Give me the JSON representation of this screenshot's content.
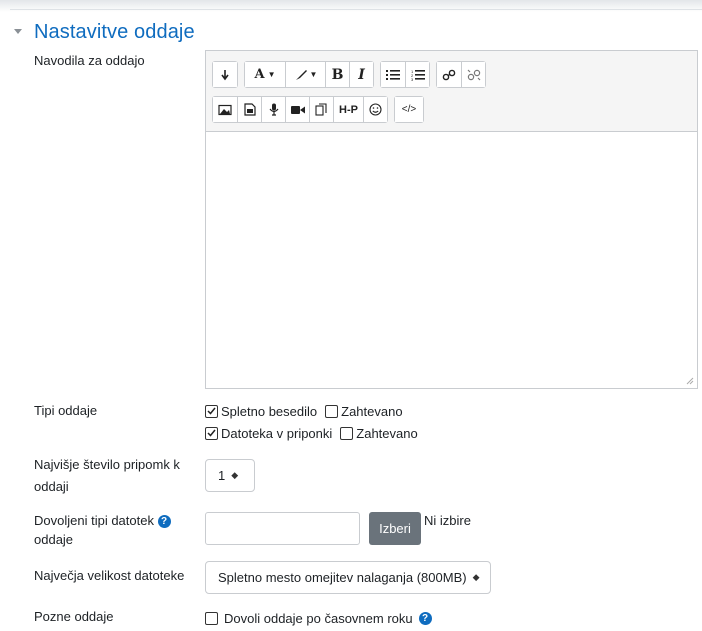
{
  "section": {
    "title": "Nastavitve oddaje",
    "collapse_icon": "chevron-down-icon"
  },
  "instructions": {
    "label": "Navodila za oddajo",
    "toolbar": {
      "row1": [
        {
          "name": "collapse-toolbar-button",
          "glyph": "↴"
        },
        {
          "name": "font-size-button",
          "glyph": "A▾"
        },
        {
          "name": "text-color-button",
          "glyph": "✎▾"
        },
        {
          "name": "bold-button",
          "glyph": "B"
        },
        {
          "name": "italic-button",
          "glyph": "I"
        },
        {
          "name": "unordered-list-button",
          "glyph": "☰"
        },
        {
          "name": "ordered-list-button",
          "glyph": "≡"
        },
        {
          "name": "link-button",
          "glyph": "🔗"
        },
        {
          "name": "unlink-button",
          "glyph": "⛓"
        }
      ],
      "row2": [
        {
          "name": "image-button",
          "glyph": "▣"
        },
        {
          "name": "media-button",
          "glyph": "▤"
        },
        {
          "name": "record-audio-button",
          "glyph": "🎙"
        },
        {
          "name": "record-video-button",
          "glyph": "■◀"
        },
        {
          "name": "manage-files-button",
          "glyph": "⧉"
        },
        {
          "name": "h5p-button",
          "glyph": "H-P"
        },
        {
          "name": "emoji-button",
          "glyph": "☺"
        },
        {
          "name": "html-button",
          "glyph": "</>"
        }
      ]
    }
  },
  "submission_types": {
    "label": "Tipi oddaje",
    "online_text": {
      "label": "Spletno besedilo",
      "checked": true
    },
    "online_text_required": {
      "label": "Zahtevano",
      "checked": false
    },
    "file": {
      "label": "Datoteka v priponki",
      "checked": true
    },
    "file_required": {
      "label": "Zahtevano",
      "checked": false
    }
  },
  "max_files": {
    "label_line1": "Najvišje število pripomk k",
    "label_line2": "oddaji",
    "value": "1"
  },
  "allowed_types": {
    "label_line1": "Dovoljeni tipi datotek",
    "label_line2": "oddaje",
    "button": "Izberi",
    "status": "Ni izbire",
    "help_icon": "question-icon"
  },
  "max_size": {
    "label": "Največja velikost datoteke",
    "value": "Spletno mesto omejitev nalaganja (800MB)"
  },
  "late": {
    "label": "Pozne oddaje",
    "checkbox_label": "Dovoli oddaje po časovnem roku",
    "checked": false,
    "help_icon": "question-icon"
  },
  "colors": {
    "accent": "#0f6cbf",
    "button_secondary": "#6a737b"
  }
}
